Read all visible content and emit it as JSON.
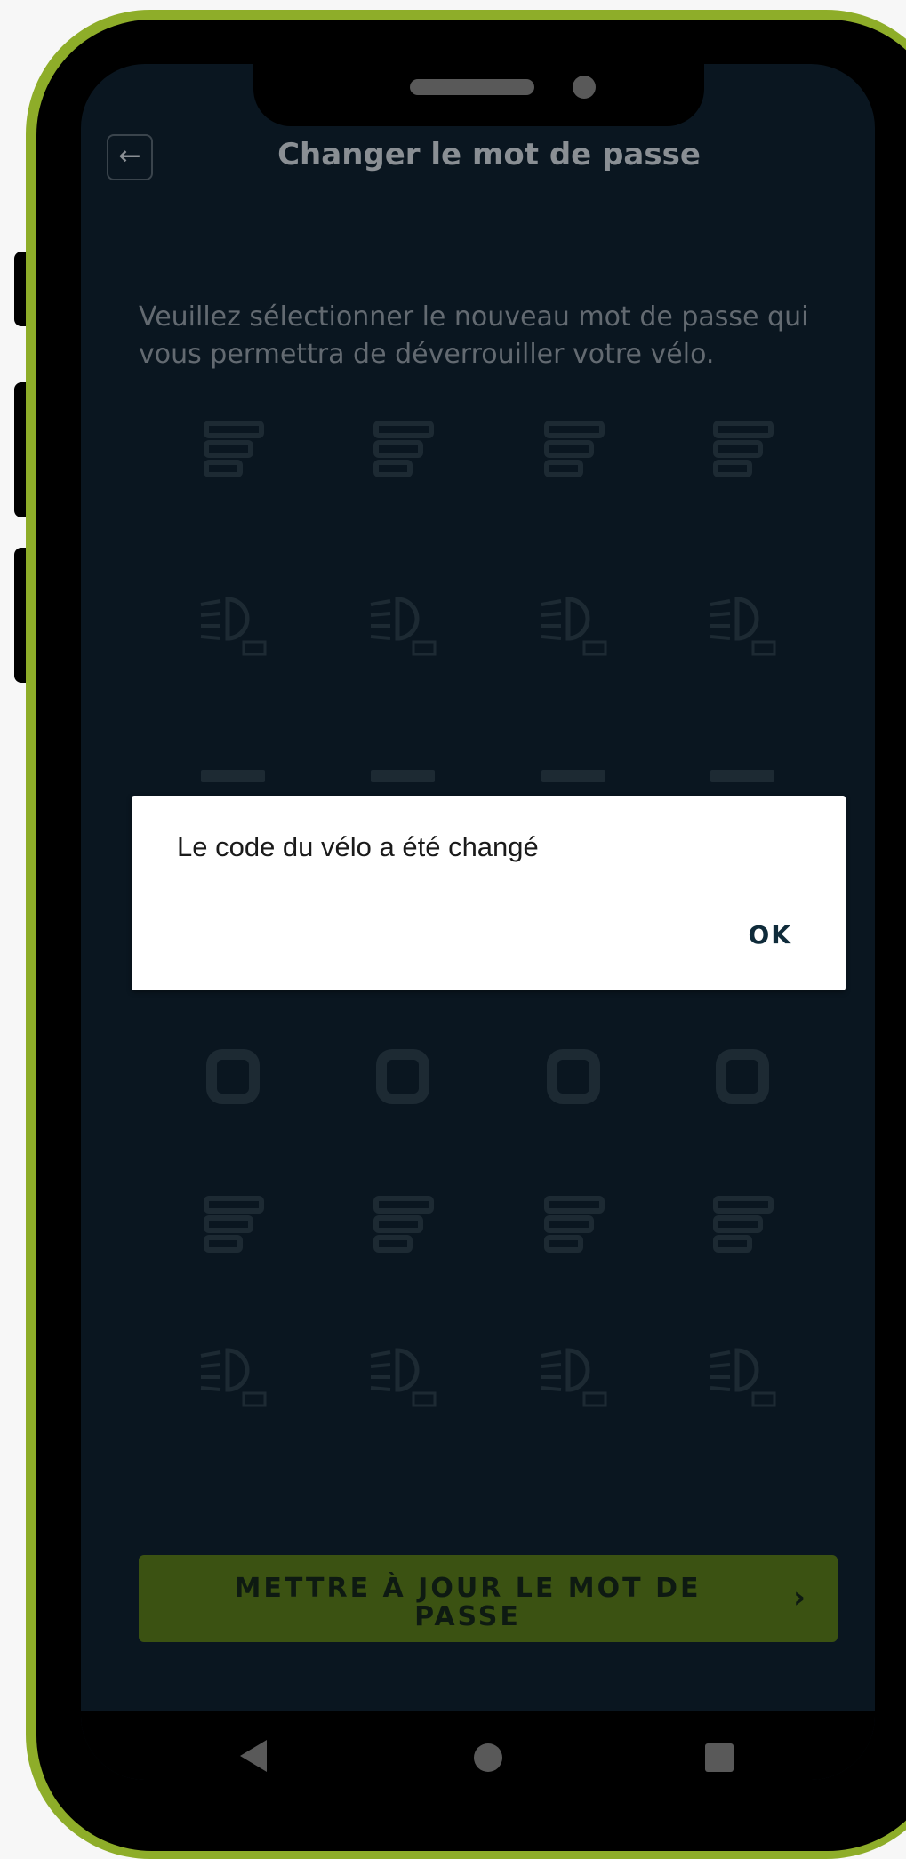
{
  "header": {
    "title": "Changer le mot de passe",
    "back_icon": "arrow-left-icon"
  },
  "instructions": "Veuillez sélectionner le nouveau mot de passe qui vous permettra de déverrouiller votre vélo.",
  "icon_rows": [
    "list-bars-icon",
    "headlight-icon",
    "dash-icon",
    "stop-square-icon",
    "list-bars-icon",
    "headlight-icon"
  ],
  "dialog": {
    "message": "Le code du vélo a été changé",
    "ok_label": "OK"
  },
  "update_button": {
    "label": "METTRE À JOUR LE MOT DE PASSE",
    "chevron": "›"
  },
  "nav_bar": {
    "back": "nav-back-icon",
    "home": "nav-home-icon",
    "recent": "nav-recent-icon"
  },
  "colors": {
    "frame_accent": "#8ead29",
    "screen_bg": "#0a1620",
    "button_bg": "#3b5212"
  }
}
